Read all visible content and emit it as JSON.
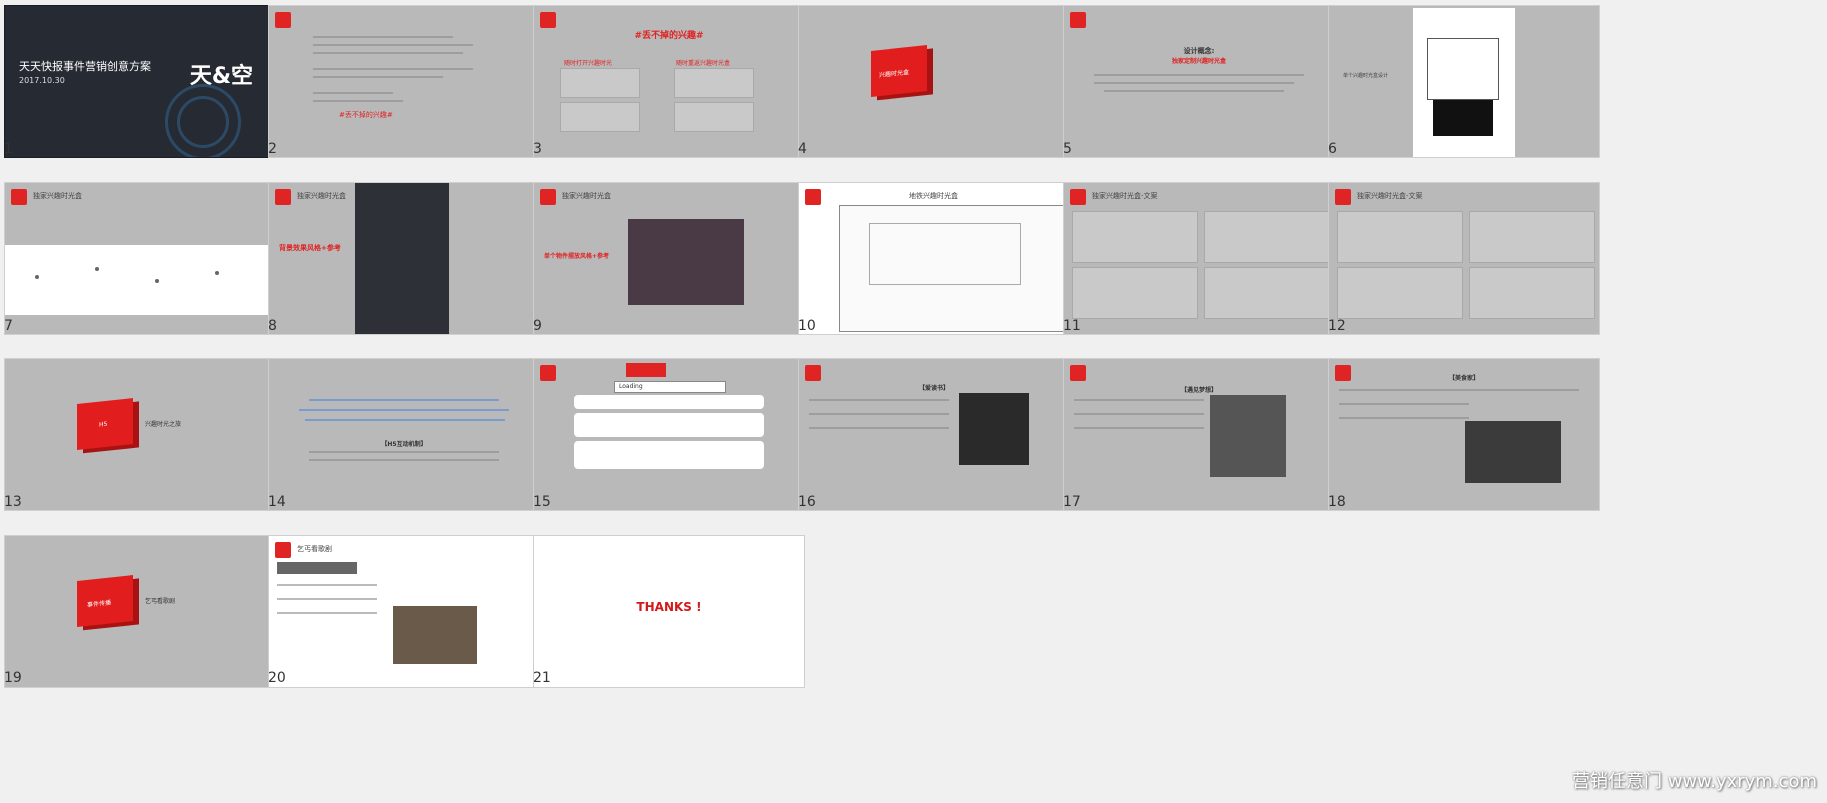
{
  "app": {
    "view": "slide_sorter",
    "watermark": "营销任意门  www.yxrym.com"
  },
  "slides": [
    {
      "num": "1",
      "title": "天天快报事件营销创意方案",
      "date": "2017.10.30",
      "brand": "天&空"
    },
    {
      "num": "2",
      "highlight": "#丢不掉的兴趣#"
    },
    {
      "num": "3",
      "heading": "#丢不掉的兴趣#",
      "left_col": "随时打开兴趣时光",
      "right_col": "随时重返兴趣时光盒"
    },
    {
      "num": "4",
      "box_label": "兴趣时光盒"
    },
    {
      "num": "5",
      "concept": "设计概念:",
      "subconcept": "独家定制兴趣时光盒"
    },
    {
      "num": "6",
      "left_caption": "单个兴趣时光盒设计"
    },
    {
      "num": "7",
      "title": "独家兴趣时光盒"
    },
    {
      "num": "8",
      "title": "独家兴趣时光盒",
      "caption": "背景效果风格+参考"
    },
    {
      "num": "9",
      "title": "独家兴趣时光盒",
      "caption": "单个物件摆放风格+参考"
    },
    {
      "num": "10",
      "title": "地铁兴趣时光盒"
    },
    {
      "num": "11",
      "title": "独家兴趣时光盒-文案"
    },
    {
      "num": "12",
      "title": "独家兴趣时光盒-文案"
    },
    {
      "num": "13",
      "box_label": "H5",
      "caption": "兴趣时光之旅"
    },
    {
      "num": "14",
      "heading": "【H5互动机制】"
    },
    {
      "num": "15",
      "label": "Loading"
    },
    {
      "num": "16",
      "heading": "【爱读书】"
    },
    {
      "num": "17",
      "heading": "【遇见梦想】"
    },
    {
      "num": "18",
      "heading": "【美食家】"
    },
    {
      "num": "19",
      "box_label": "事件传播",
      "caption": "乞丐看歌剧"
    },
    {
      "num": "20",
      "title": "乞丐看歌剧"
    },
    {
      "num": "21",
      "thanks": "THANKS !"
    }
  ]
}
